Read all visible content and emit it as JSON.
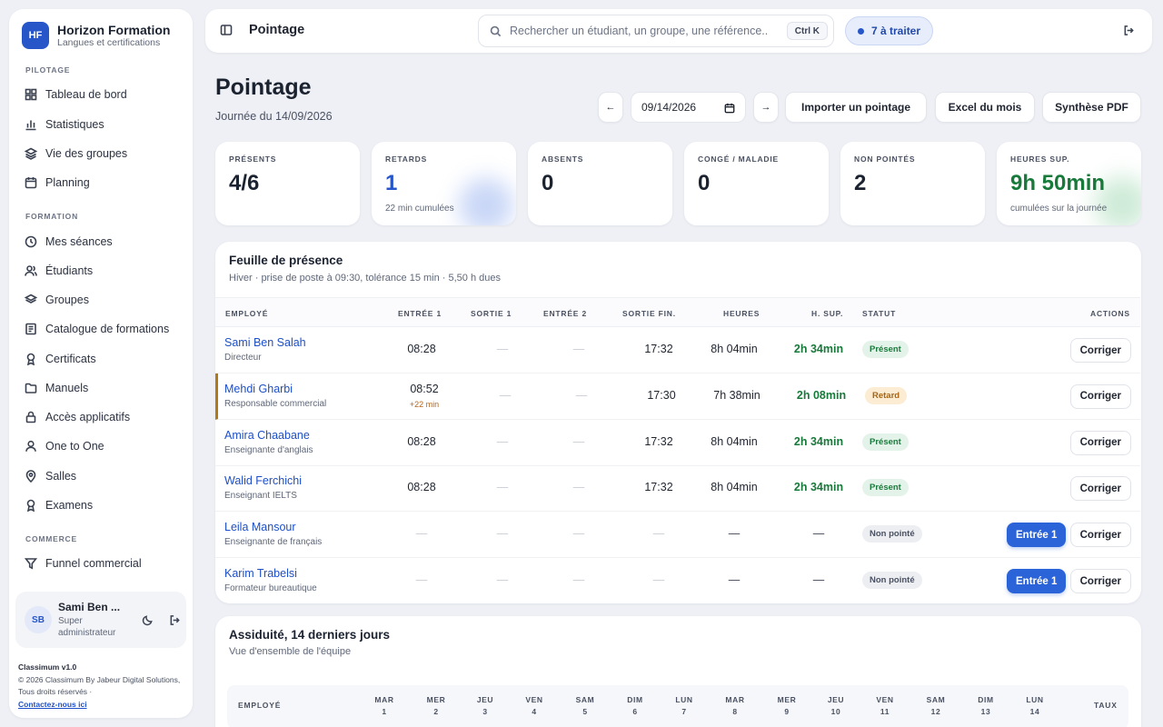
{
  "brand": {
    "logo": "HF",
    "name": "Horizon Formation",
    "subtitle": "Langues et certifications"
  },
  "sidebar": {
    "sections": [
      {
        "label": "PILOTAGE",
        "items": [
          {
            "label": "Tableau de bord",
            "icon": "grid-icon"
          },
          {
            "label": "Statistiques",
            "icon": "bar-chart-icon"
          },
          {
            "label": "Vie des groupes",
            "icon": "layers-icon"
          },
          {
            "label": "Planning",
            "icon": "calendar-icon"
          }
        ]
      },
      {
        "label": "FORMATION",
        "items": [
          {
            "label": "Mes séances",
            "icon": "clock-icon"
          },
          {
            "label": "Étudiants",
            "icon": "users-icon"
          },
          {
            "label": "Groupes",
            "icon": "stack-icon"
          },
          {
            "label": "Catalogue de formations",
            "icon": "catalog-icon"
          },
          {
            "label": "Certificats",
            "icon": "award-icon"
          },
          {
            "label": "Manuels",
            "icon": "folder-icon"
          },
          {
            "label": "Accès applicatifs",
            "icon": "lock-icon"
          },
          {
            "label": "One to One",
            "icon": "user-icon"
          },
          {
            "label": "Salles",
            "icon": "pin-icon"
          },
          {
            "label": "Examens",
            "icon": "award-icon"
          }
        ]
      },
      {
        "label": "COMMERCE",
        "items": [
          {
            "label": "Funnel commercial",
            "icon": "funnel-icon"
          }
        ]
      }
    ],
    "user": {
      "initials": "SB",
      "name": "Sami Ben ...",
      "role": "Super administrateur"
    },
    "footer": {
      "version": "Classimum v1.0",
      "copyright": "© 2026 Classimum By Jabeur Digital Solutions, Tous droits réservés ·",
      "contact": "Contactez-nous ici"
    }
  },
  "topbar": {
    "title": "Pointage",
    "search_placeholder": "Rechercher un étudiant, un groupe, une référence...",
    "shortcut": "Ctrl K",
    "pending": "7 à traiter"
  },
  "page": {
    "title": "Pointage",
    "subtitle": "Journée du 14/09/2026",
    "prev": "←",
    "next": "→",
    "date": "09/14/2026",
    "actions": [
      "Importer un pointage",
      "Excel du mois",
      "Synthèse PDF"
    ]
  },
  "stats": [
    {
      "label": "PRÉSENTS",
      "value": "4/6",
      "hint": "",
      "color": "#1b2230"
    },
    {
      "label": "RETARDS",
      "value": "1",
      "hint": "22 min cumulées",
      "color": "#2756c9"
    },
    {
      "label": "ABSENTS",
      "value": "0",
      "hint": "",
      "color": "#1b2230"
    },
    {
      "label": "CONGÉ / MALADIE",
      "value": "0",
      "hint": "",
      "color": "#1b2230"
    },
    {
      "label": "NON POINTÉS",
      "value": "2",
      "hint": "",
      "color": "#1b2230"
    },
    {
      "label": "HEURES SUP.",
      "value": "9h 50min",
      "hint": "cumulées sur la journée",
      "color": "#177a3a"
    }
  ],
  "sheet": {
    "title": "Feuille de présence",
    "subtitle": "Hiver · prise de poste à 09:30, tolérance 15 min · 5,50 h dues",
    "columns": [
      "EMPLOYÉ",
      "ENTRÉE 1",
      "SORTIE 1",
      "ENTRÉE 2",
      "SORTIE FIN.",
      "HEURES",
      "H. SUP.",
      "STATUT",
      "ACTIONS"
    ],
    "rows": [
      {
        "name": "Sami Ben Salah",
        "role": "Directeur",
        "in1": "08:28",
        "late": "",
        "out1": "—",
        "in2": "—",
        "out": "17:32",
        "hours": "8h 04min",
        "sup": "2h 34min",
        "status": "Présent",
        "status_kind": "ok",
        "entry_action": "",
        "fix": "Corriger"
      },
      {
        "name": "Mehdi Gharbi",
        "role": "Responsable commercial",
        "in1": "08:52",
        "late": "+22 min",
        "out1": "—",
        "in2": "—",
        "out": "17:30",
        "hours": "7h 38min",
        "sup": "2h 08min",
        "status": "Retard",
        "status_kind": "late",
        "entry_action": "",
        "fix": "Corriger"
      },
      {
        "name": "Amira Chaabane",
        "role": "Enseignante d'anglais",
        "in1": "08:28",
        "late": "",
        "out1": "—",
        "in2": "—",
        "out": "17:32",
        "hours": "8h 04min",
        "sup": "2h 34min",
        "status": "Présent",
        "status_kind": "ok",
        "entry_action": "",
        "fix": "Corriger"
      },
      {
        "name": "Walid Ferchichi",
        "role": "Enseignant IELTS",
        "in1": "08:28",
        "late": "",
        "out1": "—",
        "in2": "—",
        "out": "17:32",
        "hours": "8h 04min",
        "sup": "2h 34min",
        "status": "Présent",
        "status_kind": "ok",
        "entry_action": "",
        "fix": "Corriger"
      },
      {
        "name": "Leila Mansour",
        "role": "Enseignante de français",
        "in1": "—",
        "late": "",
        "out1": "—",
        "in2": "—",
        "out": "—",
        "hours": "—",
        "sup": "—",
        "status": "Non pointé",
        "status_kind": "none",
        "entry_action": "Entrée 1",
        "fix": "Corriger"
      },
      {
        "name": "Karim Trabelsi",
        "role": "Formateur bureautique",
        "in1": "—",
        "late": "",
        "out1": "—",
        "in2": "—",
        "out": "—",
        "hours": "—",
        "sup": "—",
        "status": "Non pointé",
        "status_kind": "none",
        "entry_action": "Entrée 1",
        "fix": "Corriger"
      }
    ]
  },
  "assiduity": {
    "title": "Assiduité, 14 derniers jours",
    "subtitle": "Vue d'ensemble de l'équipe",
    "employee_col": "EMPLOYÉ",
    "rate_col": "TAUX",
    "days": [
      {
        "dow": "MAR",
        "num": "1"
      },
      {
        "dow": "MER",
        "num": "2"
      },
      {
        "dow": "JEU",
        "num": "3"
      },
      {
        "dow": "VEN",
        "num": "4"
      },
      {
        "dow": "SAM",
        "num": "5"
      },
      {
        "dow": "DIM",
        "num": "6"
      },
      {
        "dow": "LUN",
        "num": "7"
      },
      {
        "dow": "MAR",
        "num": "8"
      },
      {
        "dow": "MER",
        "num": "9"
      },
      {
        "dow": "JEU",
        "num": "10"
      },
      {
        "dow": "VEN",
        "num": "11"
      },
      {
        "dow": "SAM",
        "num": "12"
      },
      {
        "dow": "DIM",
        "num": "13"
      },
      {
        "dow": "LUN",
        "num": "14"
      }
    ]
  }
}
